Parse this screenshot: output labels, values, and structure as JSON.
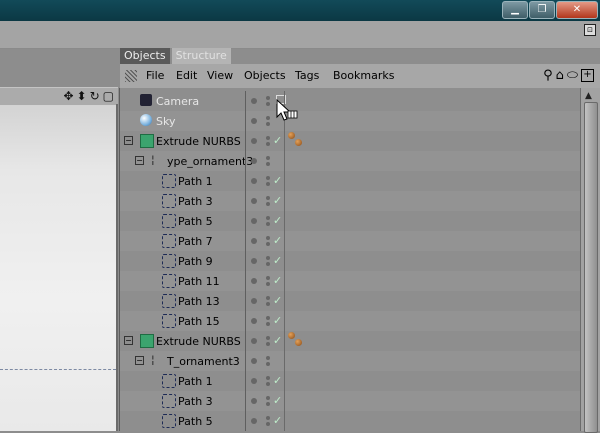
{
  "window": {
    "controls": [
      "minimize",
      "maximize",
      "close"
    ],
    "minimize_glyph": "▁",
    "maximize_glyph": "❐",
    "close_glyph": "✕",
    "corner_glyph": "⊡"
  },
  "viewport": {
    "nav_icons": [
      "move-icon",
      "zoom-icon",
      "rotate-icon",
      "maximize-icon"
    ],
    "glyphs": [
      "✥",
      "⬍",
      "↻",
      "▢"
    ]
  },
  "objects_manager": {
    "tabs": [
      {
        "label": "Objects",
        "active": true
      },
      {
        "label": "Structure",
        "active": false
      }
    ],
    "menu": [
      "File",
      "Edit",
      "View",
      "Objects",
      "Tags",
      "Bookmarks"
    ],
    "toolbar_icons": [
      "search-icon",
      "home-icon",
      "eye-icon",
      "new-window-icon"
    ],
    "toolbar_glyphs": [
      "⚲",
      "⌂",
      "⬭",
      "+"
    ],
    "check_glyph": "✓",
    "rows": [
      {
        "label": "Camera",
        "icon": "camera",
        "depth": 0,
        "expand": "",
        "check": false,
        "camera_tag": true,
        "tag": false
      },
      {
        "label": "Sky",
        "icon": "sky",
        "depth": 0,
        "expand": "",
        "check": false,
        "camera_tag": false,
        "tag": false
      },
      {
        "label": "Extrude NURBS",
        "icon": "extrude",
        "depth": 0,
        "expand": "⊟",
        "check": true,
        "camera_tag": false,
        "tag": true
      },
      {
        "label": "ype_ornament3",
        "icon": "null",
        "depth": 1,
        "expand": "⊟",
        "check": false,
        "camera_tag": false,
        "tag": false
      },
      {
        "label": "Path 1",
        "icon": "path",
        "depth": 2,
        "expand": "",
        "check": true,
        "camera_tag": false,
        "tag": false
      },
      {
        "label": "Path 3",
        "icon": "path",
        "depth": 2,
        "expand": "",
        "check": true,
        "camera_tag": false,
        "tag": false
      },
      {
        "label": "Path 5",
        "icon": "path",
        "depth": 2,
        "expand": "",
        "check": true,
        "camera_tag": false,
        "tag": false
      },
      {
        "label": "Path 7",
        "icon": "path",
        "depth": 2,
        "expand": "",
        "check": true,
        "camera_tag": false,
        "tag": false
      },
      {
        "label": "Path 9",
        "icon": "path",
        "depth": 2,
        "expand": "",
        "check": true,
        "camera_tag": false,
        "tag": false
      },
      {
        "label": "Path 11",
        "icon": "path",
        "depth": 2,
        "expand": "",
        "check": true,
        "camera_tag": false,
        "tag": false
      },
      {
        "label": "Path 13",
        "icon": "path",
        "depth": 2,
        "expand": "",
        "check": true,
        "camera_tag": false,
        "tag": false
      },
      {
        "label": "Path 15",
        "icon": "path",
        "depth": 2,
        "expand": "",
        "check": true,
        "camera_tag": false,
        "tag": false
      },
      {
        "label": "Extrude NURBS",
        "icon": "extrude",
        "depth": 0,
        "expand": "⊟",
        "check": true,
        "camera_tag": false,
        "tag": true
      },
      {
        "label": "T_ornament3",
        "icon": "null",
        "depth": 1,
        "expand": "⊟",
        "check": false,
        "camera_tag": false,
        "tag": false
      },
      {
        "label": "Path 1",
        "icon": "path",
        "depth": 2,
        "expand": "",
        "check": true,
        "camera_tag": false,
        "tag": false
      },
      {
        "label": "Path 3",
        "icon": "path",
        "depth": 2,
        "expand": "",
        "check": true,
        "camera_tag": false,
        "tag": false
      },
      {
        "label": "Path 5",
        "icon": "path",
        "depth": 2,
        "expand": "",
        "check": true,
        "camera_tag": false,
        "tag": false
      }
    ]
  },
  "colors": {
    "titlebar": "#0b3844",
    "check": "#bfeecb",
    "extrude_icon": "#3ba46e"
  }
}
